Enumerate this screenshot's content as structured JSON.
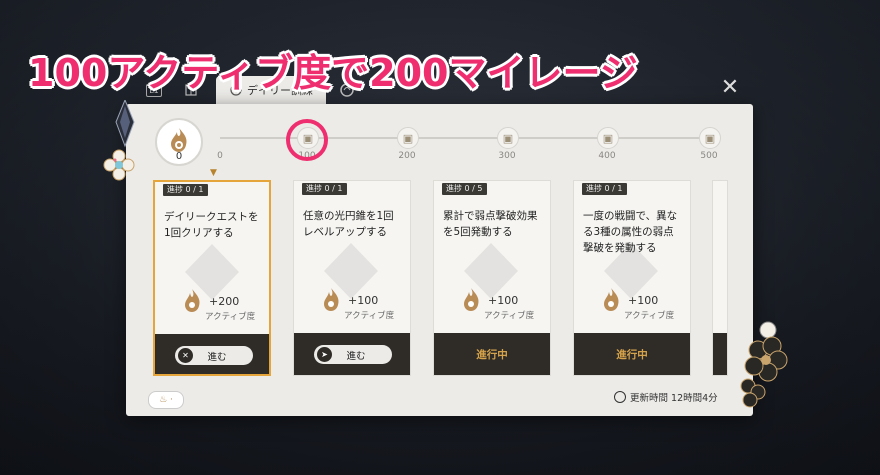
{
  "banner": "100アクティブ度で200マイレージ",
  "tabs": {
    "l1": "L1",
    "active_label": "デイリー訓練"
  },
  "activity": {
    "current": "0"
  },
  "milestones": [
    {
      "label": "0"
    },
    {
      "label": "100"
    },
    {
      "label": "200"
    },
    {
      "label": "300"
    },
    {
      "label": "400"
    },
    {
      "label": "500"
    }
  ],
  "tasks": [
    {
      "progress": "進捗 0 / 1",
      "text": "デイリークエストを1回クリアする",
      "reward": "+200",
      "reward_unit": "アクティブ度",
      "action": "進む"
    },
    {
      "progress": "進捗 0 / 1",
      "text": "任意の光円錐を1回レベルアップする",
      "reward": "+100",
      "reward_unit": "アクティブ度",
      "action": "進む"
    },
    {
      "progress": "進捗 0 / 5",
      "text": "累計で弱点撃破効果を5回発動する",
      "reward": "+100",
      "reward_unit": "アクティブ度",
      "action": "進行中"
    },
    {
      "progress": "進捗 0 / 1",
      "text": "一度の戦闘で、異なる3種の属性の弱点撃破を発動する",
      "reward": "+100",
      "reward_unit": "アクティブ度",
      "action": "進行中"
    }
  ],
  "refresh": "更新時間 12時間4分",
  "colors": {
    "accent": "#ee2e6f",
    "gold": "#d5a34c",
    "panel": "#ecebe8",
    "footer": "#2f2c27"
  }
}
